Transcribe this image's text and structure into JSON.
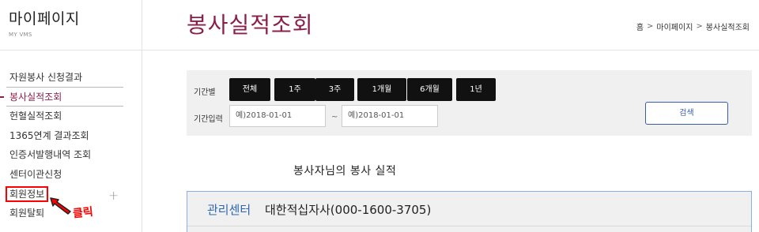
{
  "sidebar": {
    "title": "마이페이지",
    "subtitle": "MY VMS",
    "items": [
      {
        "label": "자원봉사 신청결과"
      },
      {
        "label": "봉사실적조회"
      },
      {
        "label": "헌혈실적조회"
      },
      {
        "label": "1365연계 결과조회"
      },
      {
        "label": "인증서발행내역 조회"
      },
      {
        "label": "센터이관신청"
      },
      {
        "label": "회원정보"
      },
      {
        "label": "회원탈퇴"
      }
    ],
    "plus_symbol": "+"
  },
  "annotation": {
    "text": "클릭"
  },
  "header": {
    "title": "봉사실적조회",
    "breadcrumb": [
      "홈",
      "마이페이지",
      "봉사실적조회"
    ],
    "breadcrumb_sep": ">"
  },
  "filter": {
    "period_label": "기간별",
    "period_buttons": [
      "전체",
      "1주",
      "3주",
      "1개월",
      "6개월",
      "1년"
    ],
    "date_label": "기간입력",
    "start_placeholder": "예)2018-01-01",
    "end_placeholder": "예)2018-01-01",
    "tilde": "~",
    "search_label": "검색"
  },
  "result": {
    "heading": "봉사자님의 봉사 실적",
    "center_label": "관리센터",
    "center_value": "대한적십자사(000-1600-3705)"
  },
  "colors": {
    "accent": "#8b1f4a",
    "link_blue": "#2c67b3",
    "highlight_red": "#ff0000"
  }
}
